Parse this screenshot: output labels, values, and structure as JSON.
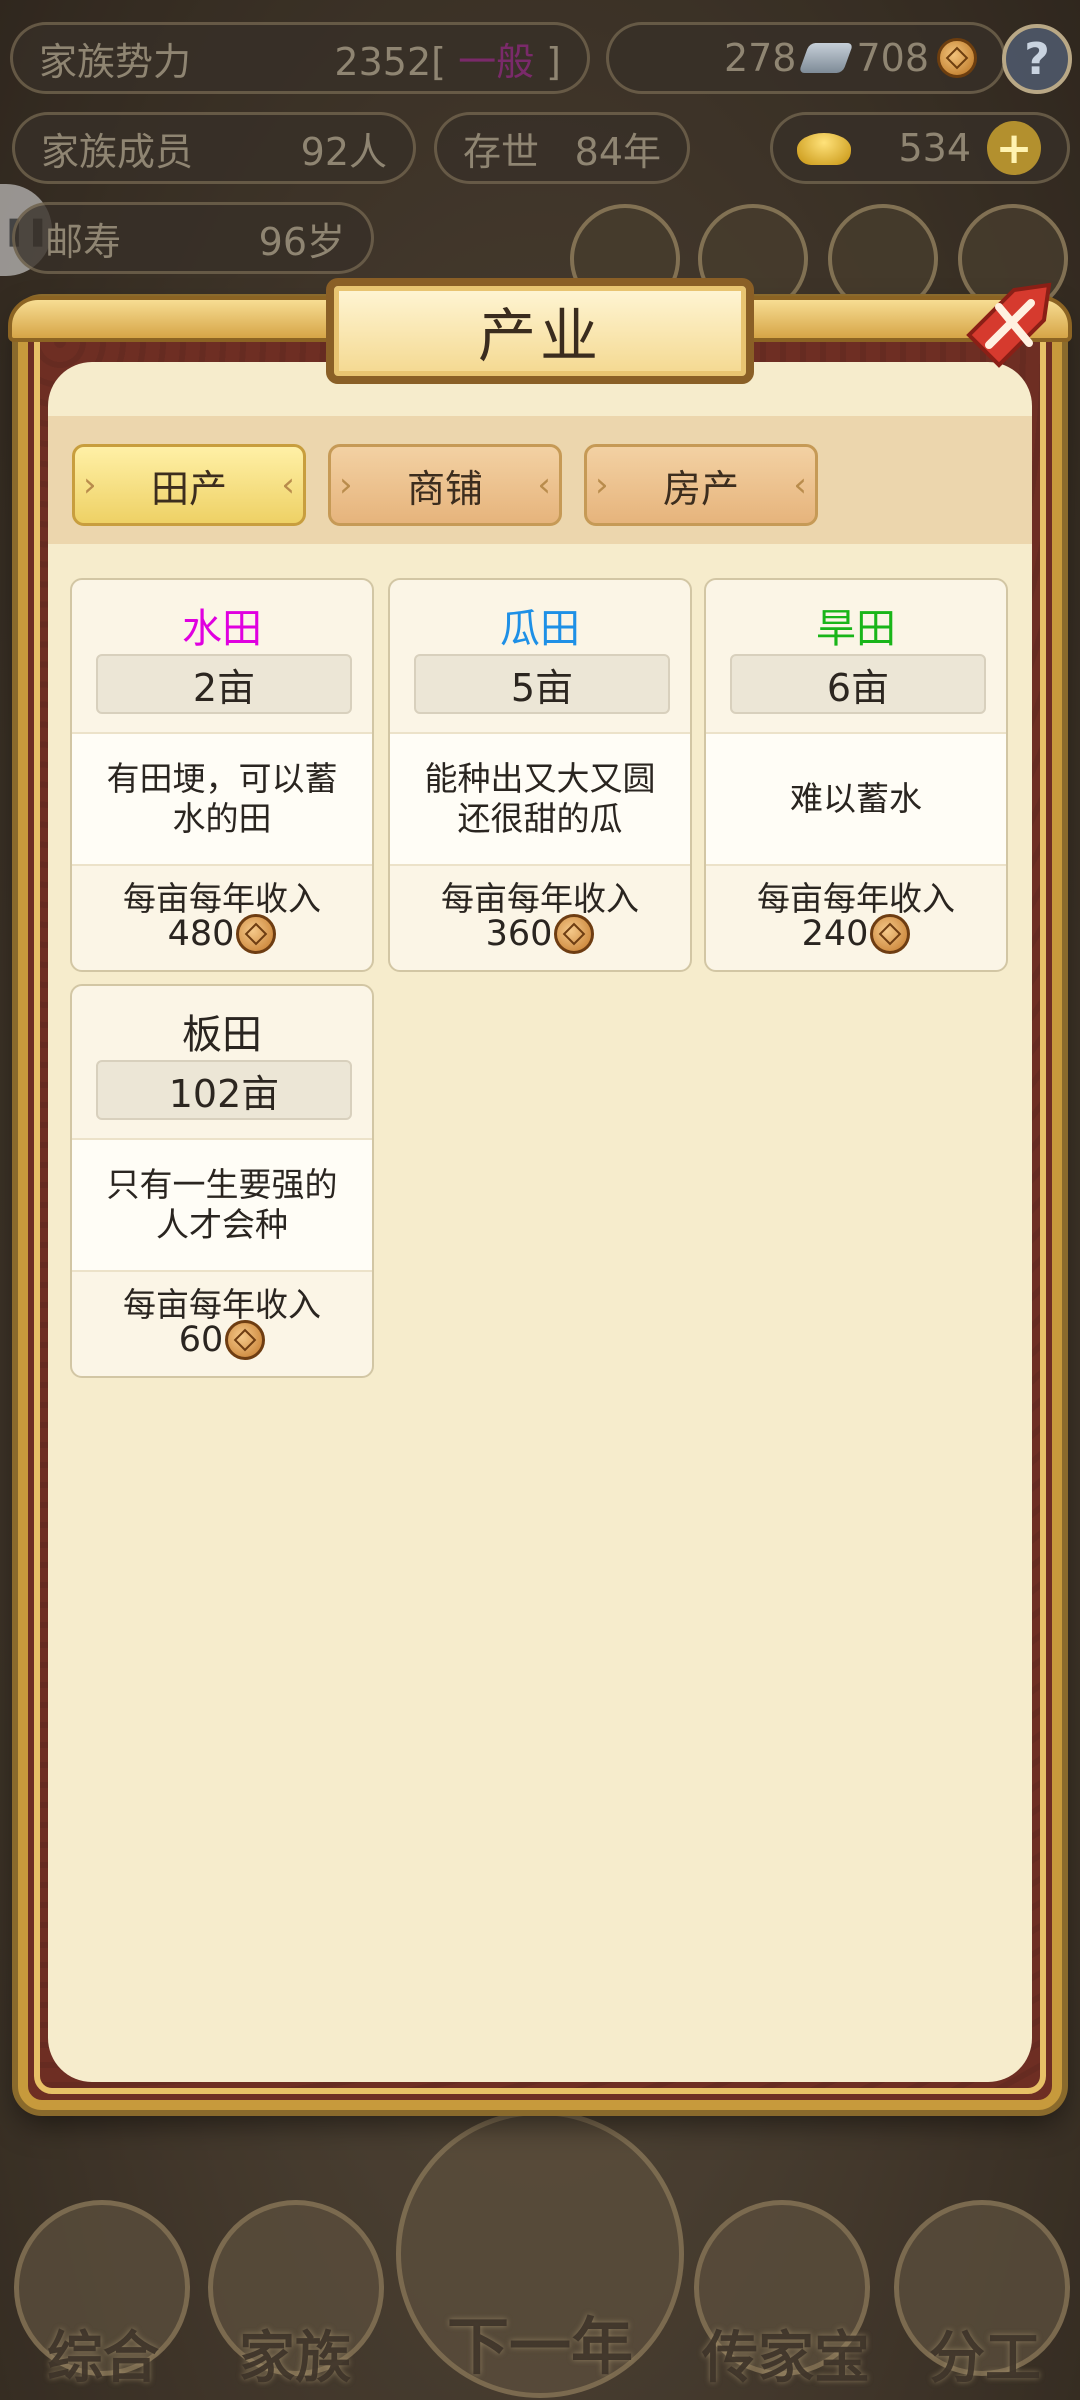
{
  "status": {
    "power_label": "家族势力",
    "power_value": "2352",
    "power_bracket_open": "[",
    "power_rank": "一般",
    "power_bracket_close": "]",
    "silver": "278",
    "copper": "708",
    "help": "?",
    "members_label": "家族成员",
    "members_value": "92人",
    "alive_label": "存世",
    "alive_value": "84年",
    "gold": "534",
    "plus": "+",
    "age_label": "邮寿",
    "age_value": "96岁",
    "side_pill": "❚❚"
  },
  "modal": {
    "title": "产业",
    "tabs": [
      {
        "label": "田产"
      },
      {
        "label": "商铺"
      },
      {
        "label": "房产"
      }
    ],
    "cards": [
      {
        "name": "水田",
        "name_color": "#e000e0",
        "area": "2亩",
        "desc": "有田埂，可以蓄水的田",
        "income_label": "每亩每年收入",
        "income": "480"
      },
      {
        "name": "瓜田",
        "name_color": "#1e90e6",
        "area": "5亩",
        "desc": "能种出又大又圆还很甜的瓜",
        "income_label": "每亩每年收入",
        "income": "360"
      },
      {
        "name": "旱田",
        "name_color": "#19b519",
        "area": "6亩",
        "desc": "难以蓄水",
        "income_label": "每亩每年收入",
        "income": "240"
      },
      {
        "name": "板田",
        "name_color": "#2a2520",
        "area": "102亩",
        "desc": "只有一生要强的人才会种",
        "income_label": "每亩每年收入",
        "income": "60"
      }
    ]
  },
  "bottom_nav": {
    "items": [
      {
        "label": "综合"
      },
      {
        "label": "家族"
      },
      {
        "label": "下一年"
      },
      {
        "label": "传家宝"
      },
      {
        "label": "分工"
      }
    ]
  }
}
